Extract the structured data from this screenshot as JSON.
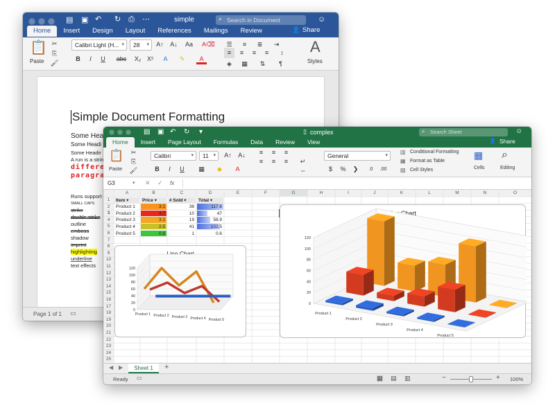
{
  "word": {
    "title": "simple",
    "search_placeholder": "Search in Document",
    "tabs": [
      "Home",
      "Insert",
      "Design",
      "Layout",
      "References",
      "Mailings",
      "Review"
    ],
    "share": "Share",
    "font_name": "Calibri Light (H...",
    "font_size": "28",
    "paste_label": "Paste",
    "styles_label": "Styles",
    "status_page": "Page 1 of 1",
    "doc": {
      "heading": "Simple Document Formatting",
      "lines": [
        "Some Head",
        "Some Headi",
        "Some Headir",
        "A run is a strin"
      ],
      "red1": "differen",
      "red2": "paragrap",
      "runs": "Runs support s",
      "caps": "SMALL CAPS",
      "strike": "strike",
      "dstrike": "double strike",
      "outline": "outline",
      "emboss": "emboss",
      "shadow": "shadow",
      "imprint": "imprint",
      "highlight": "highlighting",
      "underline": "underline",
      "effects": "text effects"
    }
  },
  "excel": {
    "title": "complex",
    "search_placeholder": "Search Sheet",
    "tabs": [
      "Home",
      "Insert",
      "Page Layout",
      "Formulas",
      "Data",
      "Review",
      "View"
    ],
    "share": "Share",
    "font_name": "Calibri",
    "font_size": "11",
    "number_format": "General",
    "paste_label": "Paste",
    "cond_format": "Conditional Formatting",
    "format_table": "Format as Table",
    "cell_styles": "Cell Styles",
    "cells_label": "Cells",
    "editing_label": "Editing",
    "name_box": "G3",
    "fx": "fx",
    "columns": [
      "A",
      "B",
      "C",
      "D",
      "E",
      "F",
      "G",
      "H",
      "I",
      "J",
      "K",
      "L",
      "M",
      "N",
      "O"
    ],
    "rows": [
      "1",
      "2",
      "3",
      "4",
      "5",
      "6",
      "7",
      "8",
      "9",
      "10",
      "11",
      "12",
      "13",
      "14",
      "15",
      "16",
      "17",
      "18",
      "19",
      "20",
      "21",
      "22",
      "23",
      "24",
      "25",
      "26"
    ],
    "table": {
      "headers": [
        "Item",
        "Price",
        "# Sold",
        "Total"
      ],
      "rows": [
        {
          "item": "Product 1",
          "price": "3.1",
          "sold": "38",
          "total": "117.8"
        },
        {
          "item": "Product 2",
          "price": "4.7",
          "sold": "10",
          "total": "47"
        },
        {
          "item": "Product 3",
          "price": "3.1",
          "sold": "19",
          "total": "58.9"
        },
        {
          "item": "Product 4",
          "price": "2.5",
          "sold": "41",
          "total": "102.5"
        },
        {
          "item": "Product 5",
          "price": "0.6",
          "sold": "1",
          "total": "0.6"
        }
      ]
    },
    "sheet_tab": "Sheet 1",
    "status_ready": "Ready",
    "zoom": "100%"
  },
  "colors": {
    "word_blue": "#2b579a",
    "excel_green": "#217346",
    "orange": "#f0951f",
    "red": "#d23b1f",
    "blue": "#2b5fc4"
  },
  "chart_data": [
    {
      "type": "line",
      "title": "Line Chart",
      "categories": [
        "Product 1",
        "Product 2",
        "Product 3",
        "Product 4",
        "Product 5"
      ],
      "ylim": [
        0,
        120
      ],
      "yticks": [
        "0",
        "20",
        "40",
        "60",
        "80",
        "100",
        "120"
      ],
      "series": [
        {
          "values": [
            60,
            120,
            70,
            110,
            20
          ],
          "color": "#d5861e"
        },
        {
          "values": [
            40,
            60,
            30,
            50,
            5
          ],
          "color": "#c0392b"
        },
        {
          "values": [
            3,
            3,
            3,
            3,
            3
          ],
          "color": "#2b5fc4"
        }
      ]
    },
    {
      "type": "bar",
      "title": "Bar Chart",
      "categories": [
        "Product 1",
        "Product 2",
        "Product 3",
        "Product 4",
        "Product 5"
      ],
      "ylim": [
        0,
        120
      ],
      "yticks": [
        "0",
        "20",
        "40",
        "60",
        "80",
        "100",
        "120"
      ],
      "series": [
        {
          "values": [
            117.8,
            47,
            58.9,
            102.5,
            0.6
          ],
          "color": "#f0951f"
        },
        {
          "values": [
            38,
            10,
            19,
            41,
            1
          ],
          "color": "#d23b1f"
        },
        {
          "values": [
            3.1,
            4.7,
            3.1,
            2.5,
            0.6
          ],
          "color": "#2b5fc4"
        }
      ]
    }
  ]
}
